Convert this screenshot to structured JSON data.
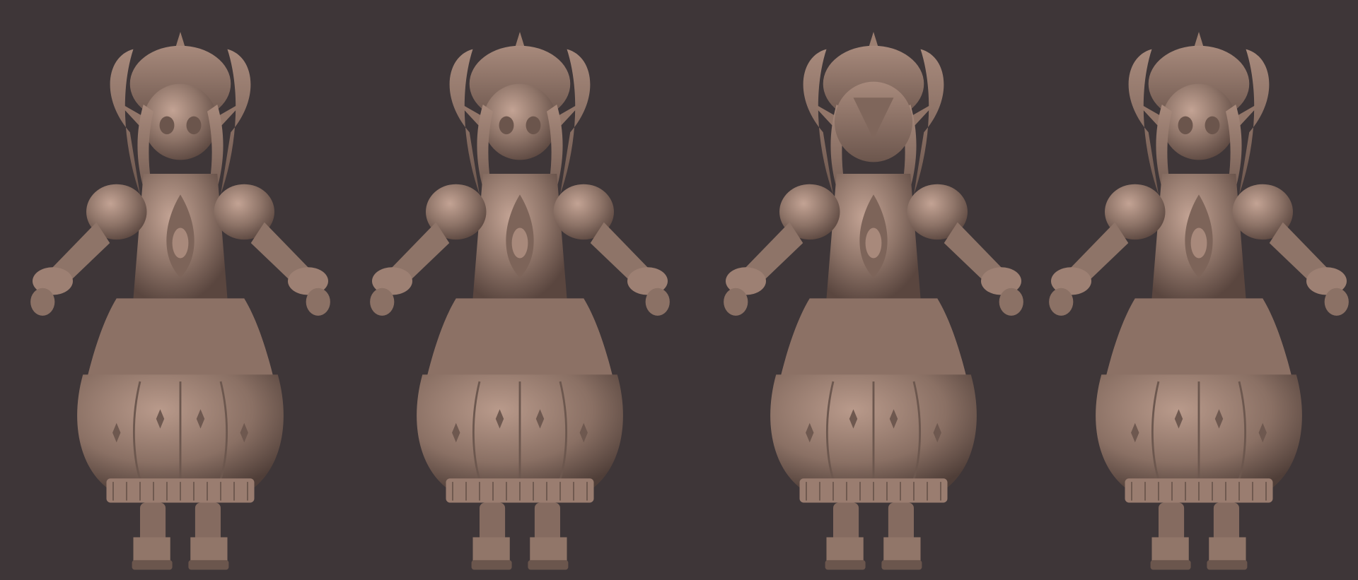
{
  "scene": {
    "background": "#3e3638",
    "clay_color": "#8e7468",
    "clay_light": "#b8988a",
    "clay_dark": "#5a463f",
    "views": [
      {
        "name": "three-quarter-left"
      },
      {
        "name": "front"
      },
      {
        "name": "back"
      },
      {
        "name": "three-quarter-right"
      }
    ]
  }
}
